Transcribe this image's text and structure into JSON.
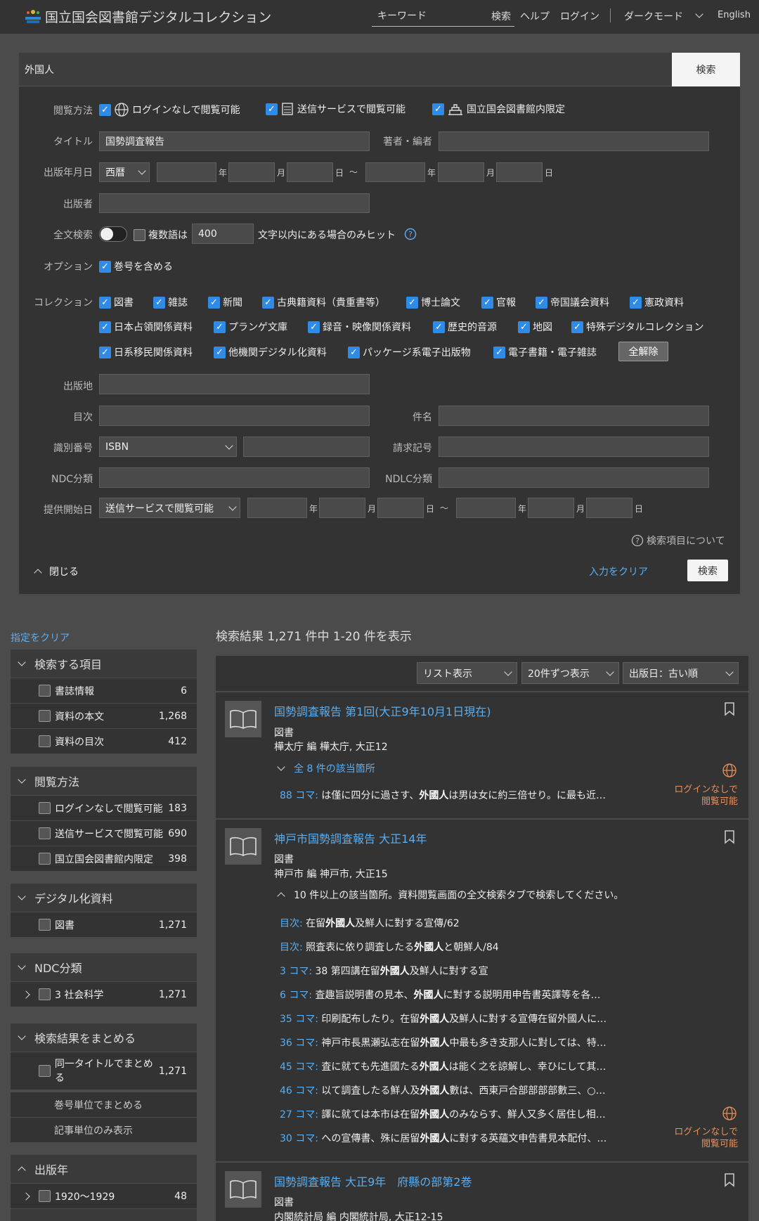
{
  "header": {
    "title": "国立国会図書館デジタルコレクション",
    "keyword_placeholder": "キーワード",
    "search": "検索",
    "help": "ヘルプ",
    "login": "ログイン",
    "dark_mode": "ダークモード",
    "english": "English"
  },
  "advanced": {
    "query": "外国人",
    "search_button": "検索",
    "labels": {
      "access": "閲覧方法",
      "title": "タイトル",
      "author": "著者・編者",
      "pubdate": "出版年月日",
      "publisher": "出版者",
      "fulltext": "全文検索",
      "option": "オプション",
      "collection": "コレクション",
      "place": "出版地",
      "toc": "目次",
      "subject": "件名",
      "id": "識別番号",
      "callno": "請求記号",
      "ndc": "NDC分類",
      "ndlc": "NDLC分類",
      "provide": "提供開始日"
    },
    "access_options": [
      "ログインなしで閲覧可能",
      "送信サービスで閲覧可能",
      "国立国会図書館内限定"
    ],
    "title_value": "国勢調査報告",
    "era": "西暦",
    "unit_year": "年",
    "unit_month": "月",
    "unit_day": "日",
    "range_sep": "〜",
    "fulltext": {
      "multi": "複数語は",
      "distance": "400",
      "suffix": "文字以内にある場合のみヒット"
    },
    "option_volume": "巻号を含める",
    "collections": [
      [
        "図書",
        "雑誌",
        "新聞",
        "古典籍資料（貴重書等）",
        "博士論文",
        "官報",
        "帝国議会資料",
        "憲政資料"
      ],
      [
        "日本占領関係資料",
        "プランゲ文庫",
        "録音・映像関係資料",
        "歴史的音源",
        "地図",
        "特殊デジタルコレクション"
      ],
      [
        "日系移民関係資料",
        "他機関デジタル化資料",
        "パッケージ系電子出版物",
        "電子書籍・電子雑誌"
      ]
    ],
    "clear_all": "全解除",
    "id_type": "ISBN",
    "provide_type": "送信サービスで閲覧可能",
    "about": "検索項目について",
    "close": "閉じる",
    "clear_input": "入力をクリア",
    "search_bottom": "検索"
  },
  "sidebar": {
    "clear": "指定をクリア",
    "groups": [
      {
        "title": "検索する項目",
        "items": [
          {
            "label": "書誌情報",
            "count": "6"
          },
          {
            "label": "資料の本文",
            "count": "1,268"
          },
          {
            "label": "資料の目次",
            "count": "412"
          }
        ]
      },
      {
        "title": "閲覧方法",
        "items": [
          {
            "label": "ログインなしで閲覧可能",
            "count": "183"
          },
          {
            "label": "送信サービスで閲覧可能",
            "count": "690"
          },
          {
            "label": "国立国会図書館内限定",
            "count": "398"
          }
        ]
      },
      {
        "title": "デジタル化資料",
        "items": [
          {
            "label": "図書",
            "count": "1,271"
          }
        ]
      },
      {
        "title": "NDC分類",
        "items": [
          {
            "label": "3 社会科学",
            "count": "1,271"
          }
        ]
      },
      {
        "title": "検索結果をまとめる",
        "items": [
          {
            "label": "同一タイトルでまとめる",
            "count": "1,271"
          },
          {
            "label": "巻号単位でまとめる",
            "count": ""
          },
          {
            "label": "記事単位のみ表示",
            "count": ""
          }
        ]
      },
      {
        "title": "出版年",
        "items": [
          {
            "label": "1920〜1929",
            "count": "48"
          }
        ]
      }
    ]
  },
  "results": {
    "summary": "検索結果 1,271 件中 1-20 件を表示",
    "view": "リスト表示",
    "per_page": "20件ずつ表示",
    "sort": "出版日：古い順",
    "access_badge": "ログインなしで閲覧可能",
    "items": [
      {
        "title": "国勢調査報告 第1回(大正9年10月1日現在)",
        "type": "図書",
        "meta": "樺太庁 編 樺太庁, 大正12",
        "hits": "全 8 件の該当箇所",
        "snippets": [
          {
            "key": "88 コマ:",
            "pre": " は僅に四分に過さす、",
            "hit": "外國人",
            "post": "は男は女に約三倍せり。に最も近…"
          }
        ]
      },
      {
        "title": "神戸市国勢調査報告 大正14年",
        "type": "図書",
        "meta": "神戸市 編 神戸市, 大正15",
        "hits": "10 件以上の該当箇所。資料閲覧画面の全文検索タブで検索してください。",
        "snippets": [
          {
            "key": "目次:",
            "pre": " 在留",
            "hit": "外國人",
            "post": "及鮮人に對する宣傳/62"
          },
          {
            "key": "目次:",
            "pre": " 照査表に依り調査したる",
            "hit": "外國人",
            "post": "と朝鮮人/84"
          },
          {
            "key": "3 コマ:",
            "pre": " 38 第四講在留",
            "hit": "外國人",
            "post": "及鮮人に對する宣"
          },
          {
            "key": "6 コマ:",
            "pre": " 査趣旨説明書の見本、",
            "hit": "外國人",
            "post": "に對する説明用申告書英譯等を各…"
          },
          {
            "key": "35 コマ:",
            "pre": " 印刷配布したり。在留",
            "hit": "外國人",
            "post": "及鮮人に對する宣傳在留外國人に…"
          },
          {
            "key": "36 コマ:",
            "pre": " 神戸市長黒瀬弘志在留",
            "hit": "外國人",
            "post": "中最も多き支那人に對しては、特…"
          },
          {
            "key": "45 コマ:",
            "pre": " 査に就ても先進國たる",
            "hit": "外國人",
            "post": "は能く之を諒解し、幸ひにして其…"
          },
          {
            "key": "46 コマ:",
            "pre": " 以て調査したる鮮人及",
            "hit": "外國人",
            "post": "數は、西東戸合部部部部數三、○…"
          },
          {
            "key": "27 コマ:",
            "pre": " 譯に就ては本市は在留",
            "hit": "外國人",
            "post": "のみならす、鮮人又多く居住し相…"
          },
          {
            "key": "30 コマ:",
            "pre": " への宣傳書、殊に居留",
            "hit": "外國人",
            "post": "に對する英蘊文申告書見本配付、…"
          }
        ]
      },
      {
        "title": "国勢調査報告 大正9年　府縣の部第2巻",
        "type": "図書",
        "meta": "内閣統計局 編 内閣統計局, 大正12-15"
      }
    ]
  }
}
